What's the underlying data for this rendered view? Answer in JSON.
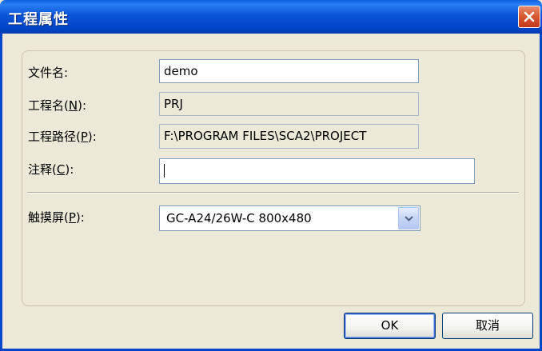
{
  "dialog": {
    "title": "工程属性",
    "close_glyph": "×"
  },
  "fields": {
    "filename": {
      "label": "文件名:",
      "value": "demo"
    },
    "project_name": {
      "label_prefix": "工程名(",
      "mnemonic": "N",
      "label_suffix": "):",
      "value": "PRJ"
    },
    "project_path": {
      "label_prefix": "工程路径(",
      "mnemonic": "P",
      "label_suffix": "):",
      "value": "F:\\PROGRAM FILES\\SCA2\\PROJECT"
    },
    "comment": {
      "label_prefix": "注释(",
      "mnemonic": "C",
      "label_suffix": "):",
      "value": ""
    }
  },
  "touchscreen": {
    "label_prefix": "触摸屏(",
    "mnemonic": "P",
    "label_suffix": "):",
    "selected": "GC-A24/26W-C 800x480"
  },
  "buttons": {
    "ok": "OK",
    "cancel": "取消"
  },
  "colors": {
    "titlebar": "#0046c8",
    "dialog_bg": "#ece9d8",
    "close_button": "#d9562f"
  }
}
